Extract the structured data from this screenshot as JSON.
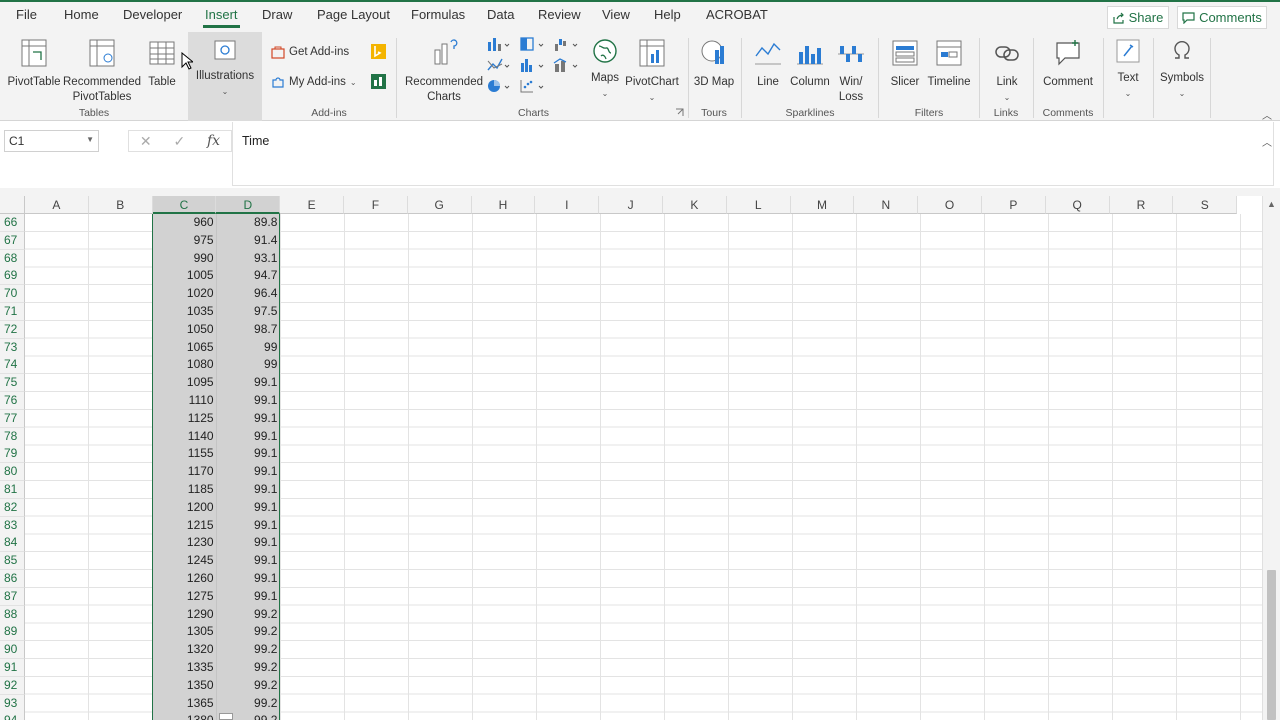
{
  "tabs": [
    "File",
    "Home",
    "Developer",
    "Insert",
    "Draw",
    "Page Layout",
    "Formulas",
    "Data",
    "Review",
    "View",
    "Help",
    "ACROBAT"
  ],
  "active_tab": "Insert",
  "share_label": "Share",
  "comments_label": "Comments",
  "ribbon": {
    "pivottable": "PivotTable",
    "recommended_pivottables": "Recommended PivotTables",
    "table": "Table",
    "tables_group": "Tables",
    "illustrations": "Illustrations",
    "get_addins": "Get Add-ins",
    "my_addins": "My Add-ins",
    "addins_group": "Add-ins",
    "recommended_charts": "Recommended Charts",
    "maps": "Maps",
    "pivotchart": "PivotChart",
    "charts_group": "Charts",
    "map3d": "3D Map",
    "tours_group": "Tours",
    "line": "Line",
    "column": "Column",
    "winloss": "Win/ Loss",
    "sparklines_group": "Sparklines",
    "slicer": "Slicer",
    "timeline": "Timeline",
    "filters_group": "Filters",
    "link": "Link",
    "links_group": "Links",
    "comment": "Comment",
    "comments_group": "Comments",
    "text": "Text",
    "symbols": "Symbols"
  },
  "namebox": "C1",
  "formula_value": "Time",
  "fx": "fx",
  "columns": [
    "A",
    "B",
    "C",
    "D",
    "E",
    "F",
    "G",
    "H",
    "I",
    "J",
    "K",
    "L",
    "M",
    "N",
    "O",
    "P",
    "Q",
    "R",
    "S"
  ],
  "selected_columns": [
    "C",
    "D"
  ],
  "rows": [
    {
      "n": "66",
      "c": "960",
      "d": "89.8"
    },
    {
      "n": "67",
      "c": "975",
      "d": "91.4"
    },
    {
      "n": "68",
      "c": "990",
      "d": "93.1"
    },
    {
      "n": "69",
      "c": "1005",
      "d": "94.7"
    },
    {
      "n": "70",
      "c": "1020",
      "d": "96.4"
    },
    {
      "n": "71",
      "c": "1035",
      "d": "97.5"
    },
    {
      "n": "72",
      "c": "1050",
      "d": "98.7"
    },
    {
      "n": "73",
      "c": "1065",
      "d": "99"
    },
    {
      "n": "74",
      "c": "1080",
      "d": "99"
    },
    {
      "n": "75",
      "c": "1095",
      "d": "99.1"
    },
    {
      "n": "76",
      "c": "1110",
      "d": "99.1"
    },
    {
      "n": "77",
      "c": "1125",
      "d": "99.1"
    },
    {
      "n": "78",
      "c": "1140",
      "d": "99.1"
    },
    {
      "n": "79",
      "c": "1155",
      "d": "99.1"
    },
    {
      "n": "80",
      "c": "1170",
      "d": "99.1"
    },
    {
      "n": "81",
      "c": "1185",
      "d": "99.1"
    },
    {
      "n": "82",
      "c": "1200",
      "d": "99.1"
    },
    {
      "n": "83",
      "c": "1215",
      "d": "99.1"
    },
    {
      "n": "84",
      "c": "1230",
      "d": "99.1"
    },
    {
      "n": "85",
      "c": "1245",
      "d": "99.1"
    },
    {
      "n": "86",
      "c": "1260",
      "d": "99.1"
    },
    {
      "n": "87",
      "c": "1275",
      "d": "99.1"
    },
    {
      "n": "88",
      "c": "1290",
      "d": "99.2"
    },
    {
      "n": "89",
      "c": "1305",
      "d": "99.2"
    },
    {
      "n": "90",
      "c": "1320",
      "d": "99.2"
    },
    {
      "n": "91",
      "c": "1335",
      "d": "99.2"
    },
    {
      "n": "92",
      "c": "1350",
      "d": "99.2"
    },
    {
      "n": "93",
      "c": "1365",
      "d": "99.2"
    },
    {
      "n": "94",
      "c": "1380",
      "d": "99.2"
    }
  ],
  "colors": {
    "accent": "#217346",
    "selection": "#d2d2d2"
  }
}
